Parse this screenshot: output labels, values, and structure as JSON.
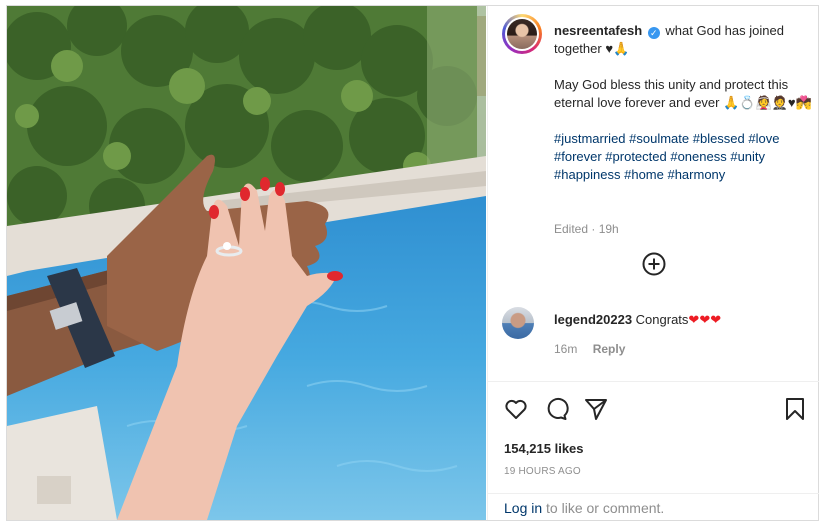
{
  "post": {
    "author": {
      "username": "nesreentafesh",
      "verified": true,
      "caption_title": "what God has joined together ♥🙏",
      "caption_body": "May God bless this unity and protect this eternal love forever and ever 🙏💍👰🤵♥💏",
      "hashtags": "#justmarried #soulmate #blessed #love #forever #protected #oneness #unity #happiness #home #harmony",
      "edited_label": "Edited · 19h"
    },
    "comment": {
      "username": "legend20223",
      "text": "Congrats",
      "hearts": "❤❤❤",
      "age": "16m",
      "reply_label": "Reply"
    },
    "likes_label": "154,215 likes",
    "timestamp": "19 hours ago",
    "login_link": "Log in",
    "login_suffix": " to like or comment."
  },
  "icons": {
    "more_comments": "plus-circle-icon",
    "like": "heart-icon",
    "comment": "comment-icon",
    "share": "share-icon",
    "save": "bookmark-icon"
  },
  "colors": {
    "verified_blue": "#3897f0",
    "hashtag_link": "#00376b",
    "secondary_text": "#8e8e8e",
    "heart_red": "#ed1c24"
  }
}
